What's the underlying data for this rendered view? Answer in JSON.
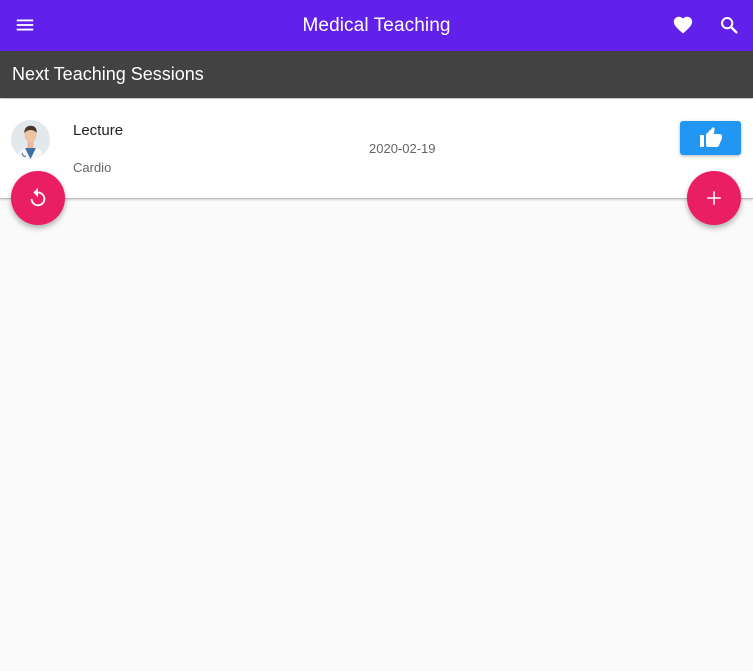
{
  "app_bar": {
    "title": "Medical Teaching",
    "icons": {
      "menu": "menu-icon",
      "favorite": "heart-icon",
      "search": "search-icon"
    }
  },
  "section": {
    "title": "Next Teaching Sessions"
  },
  "sessions": [
    {
      "type": "Lecture",
      "topic": "Cardio",
      "date": "2020-02-19",
      "avatar": "doctor-avatar",
      "action_icon": "thumbs-up-icon"
    }
  ],
  "fabs": {
    "refresh_icon": "refresh-icon",
    "add_icon": "plus-icon"
  },
  "colors": {
    "app_bar": "#6221ea",
    "section_header": "#424242",
    "like_button": "#2196f3",
    "fab": "#e91e63",
    "background": "#fafafa"
  }
}
